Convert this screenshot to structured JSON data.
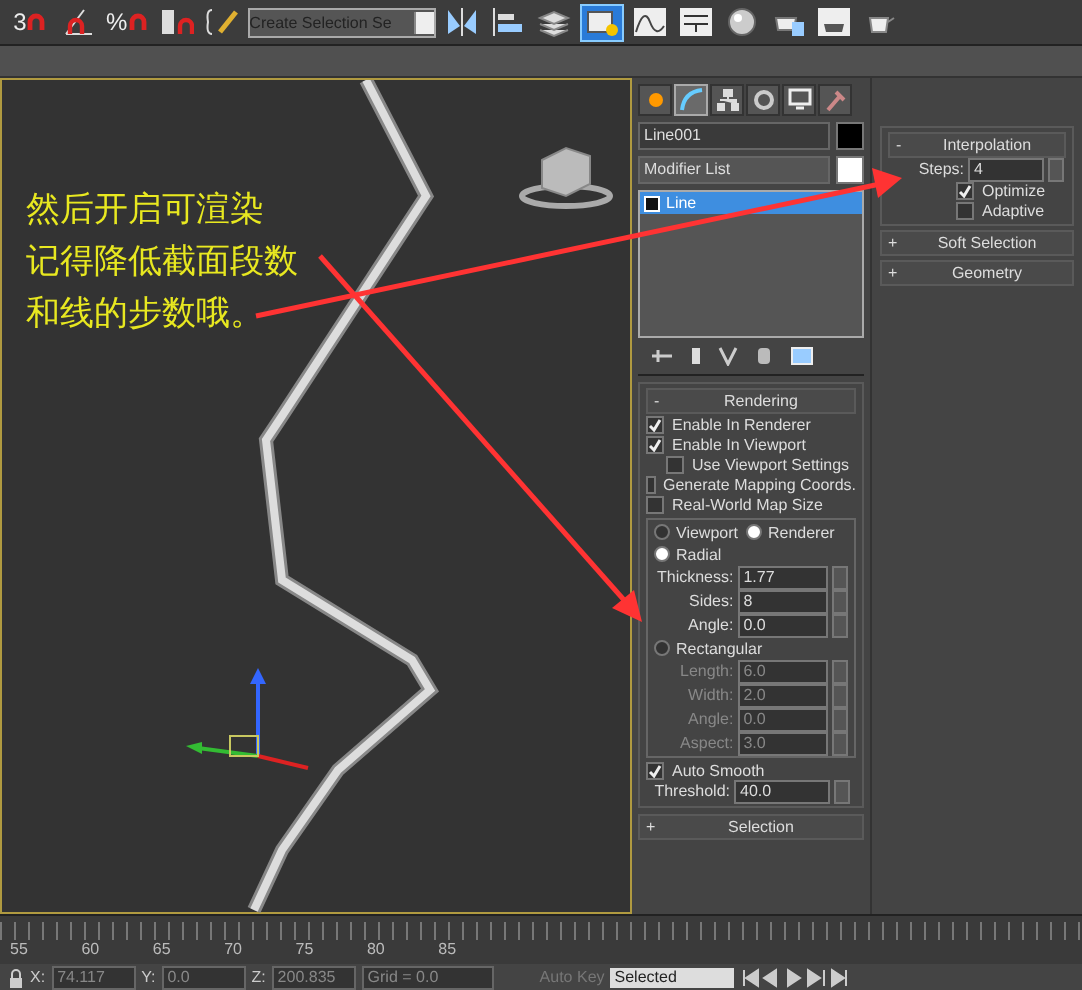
{
  "toolbar": {
    "items": [
      {
        "kind": "snap",
        "label": "3",
        "selected": false
      },
      {
        "kind": "angle-snap",
        "selected": false
      },
      {
        "kind": "snap",
        "label": "%",
        "selected": false
      },
      {
        "kind": "spinner-snap",
        "selected": false
      },
      {
        "kind": "named-sel",
        "selected": false
      },
      {
        "kind": "dropdown",
        "label": "Create Selection Se",
        "selected": false
      },
      {
        "kind": "mirror",
        "selected": false
      },
      {
        "kind": "align",
        "selected": false
      },
      {
        "kind": "layers",
        "selected": false
      },
      {
        "kind": "explorer",
        "selected": true
      },
      {
        "kind": "curve",
        "selected": false
      },
      {
        "kind": "schematic",
        "selected": false
      },
      {
        "kind": "material",
        "selected": false
      },
      {
        "kind": "render-setup",
        "selected": false
      },
      {
        "kind": "render-frame",
        "selected": false
      },
      {
        "kind": "teapot",
        "selected": false
      }
    ]
  },
  "viewport": {
    "annotation": [
      "然后开启可渲染",
      "记得降低截面段数",
      "和线的步数哦。"
    ]
  },
  "command_panel": {
    "tabs": [
      {
        "kind": "create",
        "selected": false
      },
      {
        "kind": "modify",
        "selected": true
      },
      {
        "kind": "hierarchy",
        "selected": false
      },
      {
        "kind": "motion",
        "selected": false
      },
      {
        "kind": "display",
        "selected": false
      },
      {
        "kind": "utilities",
        "selected": false
      }
    ],
    "object_name": "Line001",
    "modifier_list": "Modifier List",
    "stack": [
      {
        "label": "Line",
        "selected": true
      }
    ],
    "rendering": {
      "sign": "-",
      "title": "Rendering",
      "options": [
        {
          "label": "Enable In Renderer",
          "checked": true
        },
        {
          "label": "Enable In Viewport",
          "checked": true,
          "children": [
            {
              "label": "Use Viewport Settings",
              "checked": false
            }
          ]
        },
        {
          "label": "Generate Mapping Coords.",
          "checked": false
        },
        {
          "label": "Real-World Map Size",
          "checked": false
        }
      ],
      "display_modes": [
        {
          "label": "Viewport",
          "selected": false
        },
        {
          "label": "Renderer",
          "selected": true
        }
      ],
      "shapes": [
        {
          "label": "Radial",
          "selected": true,
          "fields": [
            {
              "label": "Thickness:",
              "value": "1.77"
            },
            {
              "label": "Sides:",
              "value": "8"
            },
            {
              "label": "Angle:",
              "value": "0.0"
            }
          ]
        },
        {
          "label": "Rectangular",
          "selected": false,
          "fields": [
            {
              "label": "Length:",
              "value": "6.0"
            },
            {
              "label": "Width:",
              "value": "2.0"
            },
            {
              "label": "Angle:",
              "value": "0.0"
            },
            {
              "label": "Aspect:",
              "value": "3.0"
            }
          ]
        }
      ],
      "auto_smooth": {
        "label": "Auto Smooth",
        "checked": true
      },
      "threshold": {
        "label": "Threshold:",
        "value": "40.0"
      }
    },
    "selection_rollout": {
      "sign": "+",
      "title": "Selection"
    }
  },
  "rollouts": [
    {
      "sign": "-",
      "title": "Interpolation",
      "steps": {
        "label": "Steps:",
        "value": "4"
      },
      "options": [
        {
          "label": "Optimize",
          "checked": true
        },
        {
          "label": "Adaptive",
          "checked": false
        }
      ]
    },
    {
      "sign": "+",
      "title": "Soft Selection"
    },
    {
      "sign": "+",
      "title": "Geometry"
    }
  ],
  "timeline": {
    "ticks": [
      "55",
      "60",
      "65",
      "70",
      "75",
      "80",
      "85"
    ]
  },
  "status_bar": {
    "coords": [
      {
        "label": "X:",
        "value": "74.117"
      },
      {
        "label": "Y:",
        "value": "0.0"
      },
      {
        "label": "Z:",
        "value": "200.835"
      }
    ],
    "grid": "Grid = 0.0",
    "auto_key": "Auto Key",
    "key_filter": "Selected"
  }
}
